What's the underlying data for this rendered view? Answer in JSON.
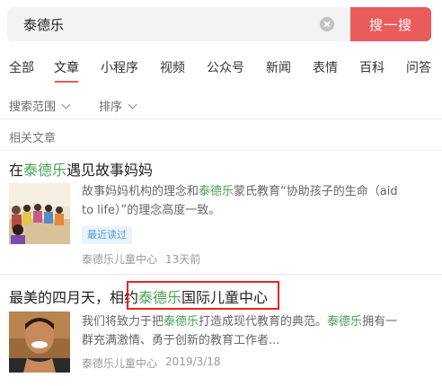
{
  "search": {
    "query": "泰德乐",
    "button_label": "搜一搜"
  },
  "tabs": [
    "全部",
    "文章",
    "小程序",
    "视频",
    "公众号",
    "新闻",
    "表情",
    "百科",
    "问答"
  ],
  "active_tab": "文章",
  "filters": {
    "range": "搜索范围",
    "sort": "排序"
  },
  "section_label": "相关文章",
  "results": [
    {
      "title_pre": "在",
      "title_kw": "泰德乐",
      "title_post": "遇见故事妈妈",
      "excerpt_line1_pre": "故事妈妈机构的理念和",
      "excerpt_line1_kw": "泰德乐",
      "excerpt_line1_post": "蒙氏教育“协助孩子的生命（aid",
      "excerpt_line2": "to life）”的理念高度一致。",
      "tag": "最近读过",
      "source": "泰德乐儿童中心",
      "time": "13天前"
    },
    {
      "title_pre": "最美的四月天，相约",
      "title_kw": "泰德乐",
      "title_post": "国际儿童中心",
      "excerpt_line1_pre": "我们将致力于把",
      "excerpt_line1_kw": "泰德乐",
      "excerpt_line1_mid": "打造成现代教育的典范。",
      "excerpt_line1_kw2": "泰德乐",
      "excerpt_line1_post": "拥有一",
      "excerpt_line2": "群充满激情、勇于创新的教育工作者...",
      "source": "泰德乐儿童中心",
      "time": "2019/3/18"
    }
  ],
  "colors": {
    "keyword": "#4aa154",
    "search_button": "#ea5b5b",
    "tab_underline": "#e95a57",
    "highlight_box": "#e8251e",
    "tag_text": "#4f9bd9"
  }
}
